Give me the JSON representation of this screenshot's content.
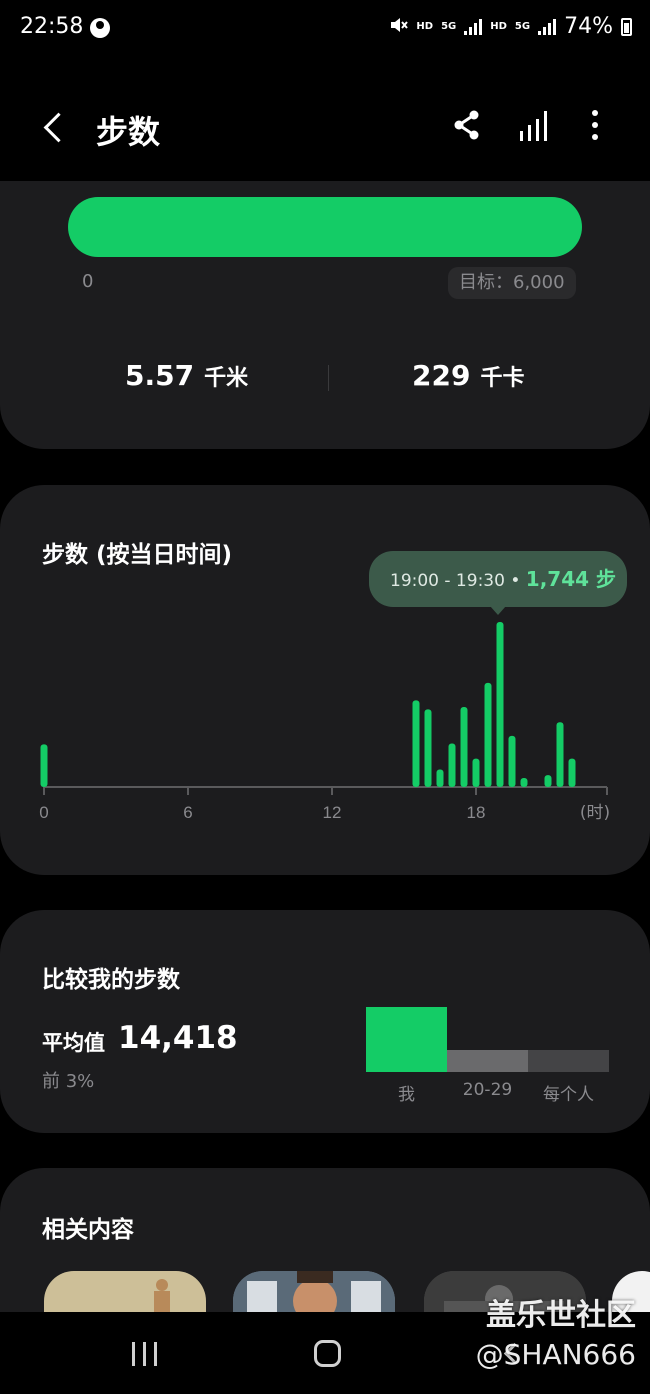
{
  "status_bar": {
    "time": "22:58",
    "hd1": "HD",
    "net1": "5G",
    "hd2": "HD",
    "net2": "5G",
    "battery": "74%"
  },
  "header": {
    "title": "步数"
  },
  "summary": {
    "progress_fraction": 1.0,
    "progress_start": "0",
    "goal": "目标：6,000",
    "distance_value": "5.57",
    "distance_unit": "千米",
    "calories_value": "229",
    "calories_unit": "千卡"
  },
  "hourly": {
    "title": "步数 (按当日时间)",
    "tooltip_range": "19:00 - 19:30",
    "tooltip_sep": " • ",
    "tooltip_value": "1,744 步",
    "x_unit": "(时)"
  },
  "chart_data": {
    "type": "bar",
    "x_unit": "(时)",
    "xlim": [
      0,
      24
    ],
    "ylim": [
      0,
      1744
    ],
    "x_ticks": [
      0,
      6,
      12,
      18
    ],
    "x": [
      0.0,
      15.5,
      16.0,
      16.5,
      17.0,
      17.5,
      18.0,
      18.5,
      19.0,
      19.5,
      20.0,
      21.0,
      21.5,
      22.0
    ],
    "values": [
      450,
      915,
      820,
      185,
      460,
      845,
      300,
      1100,
      1744,
      540,
      95,
      125,
      685,
      300
    ],
    "highlight": {
      "x": 19.0,
      "value": 1744,
      "label": "19:00 - 19:30 • 1,744 步"
    }
  },
  "comparison": {
    "title": "比较我的步数",
    "avg_label": "平均值",
    "avg_value": "14,418",
    "rank": "前 3%",
    "bars": [
      {
        "label": "我",
        "color": "#14cc66"
      },
      {
        "label": "20-29",
        "color": "#6a6a6c"
      },
      {
        "label": "每个人",
        "color": "#444446"
      }
    ]
  },
  "related": {
    "title": "相关内容"
  },
  "watermark": {
    "line1": "盖乐世社区",
    "line2": "@SHAN666"
  },
  "colors": {
    "accent": "#14cc66",
    "card_bg": "#1c1c1e",
    "muted_text": "#8a8a8e",
    "tooltip_bg": "#3c5a4a"
  }
}
